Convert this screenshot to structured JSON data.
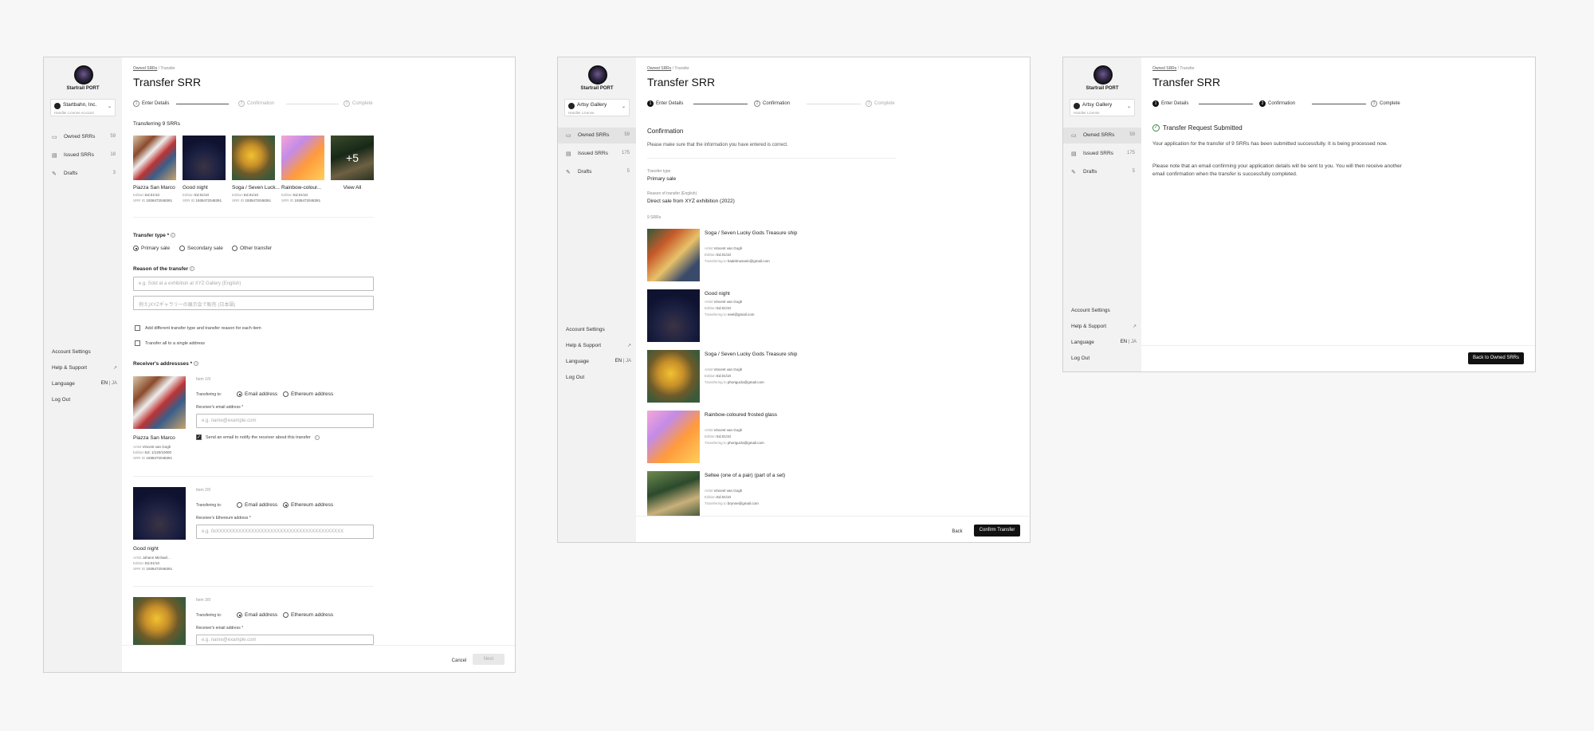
{
  "sidebar": {
    "brand": "Startrail PORT",
    "nav": [
      {
        "label": "Owned SRRs"
      },
      {
        "label": "Issued SRRs"
      },
      {
        "label": "Drafts"
      }
    ],
    "bottom": {
      "account_settings": "Account Settings",
      "help": "Help & Support",
      "language": "Language",
      "lang_en": "EN",
      "lang_ja": "JA",
      "logout": "Log Out"
    }
  },
  "screens": [
    {
      "account": {
        "name": "Startbahn, Inc.",
        "role": "Handler License Account"
      },
      "nav_counts": [
        "59",
        "18",
        "3"
      ],
      "breadcrumb": {
        "link": "Owned SRRs",
        "current": "Transfer"
      },
      "title": "Transfer SRR",
      "steps": [
        "Enter Details",
        "Confirmation",
        "Complete"
      ],
      "transferring_label": "Transferring 9 SRRs",
      "items": [
        {
          "name": "Piazza San Marco",
          "edition_label": "Edition",
          "edition": "Ed.01/10",
          "srr_label": "SRR ID",
          "srr": "1938472048391"
        },
        {
          "name": "Good night",
          "edition_label": "Edition",
          "edition": "Ed.01/10",
          "srr_label": "SRR ID",
          "srr": "1938472048391"
        },
        {
          "name": "Soga / Seven Luck...",
          "edition_label": "Edition",
          "edition": "Ed.01/10",
          "srr_label": "SRR ID",
          "srr": "1938472048391"
        },
        {
          "name": "Rainbow-colour...",
          "edition_label": "Edition",
          "edition": "Ed.01/10",
          "srr_label": "SRR ID",
          "srr": "1938472048391"
        }
      ],
      "more_count": "+5",
      "view_all": "View All",
      "transfer_type_label": "Transfer type *",
      "transfer_type_options": [
        "Primary sale",
        "Secondary sale",
        "Other transfer"
      ],
      "reason_label": "Reason of the transfer",
      "reason_placeholder_en": "e.g. Sold at a exhibition at XYZ Gallery (English)",
      "reason_placeholder_ja": "例え)XYZギャラリーの展示会で販売 (日本語)",
      "checkbox_different": "Add different transfer type and transfer reason for each item",
      "checkbox_single": "Transfer all to a single address",
      "receivers_label": "Receiver's addressses *",
      "receivers": [
        {
          "item": "Item 1/9",
          "name": "Piazza San Marco",
          "artist_label": "Artist",
          "artist": "Vincent van Gogh",
          "edition_label": "Edition",
          "edition": "Ed. 1/120/10000",
          "srr_label": "SRR ID",
          "srr": "1938472048391",
          "to_label": "Transfering to:",
          "opt_email": "Email address",
          "opt_eth": "Ethereum address",
          "field_label": "Receiver's email address *",
          "placeholder": "e.g. name@example.com",
          "notify": "Send an email to notify the receiver about this transfer"
        },
        {
          "item": "Item 2/9",
          "name": "Good night",
          "artist_label": "Artist",
          "artist": "Johann Michael...",
          "edition_label": "Edition",
          "edition": "Ed.01/10",
          "srr_label": "SRR ID",
          "srr": "1938472048391",
          "to_label": "Transfering to:",
          "opt_email": "Email address",
          "opt_eth": "Ethereum address",
          "field_label": "Receiver's Ethereum address *",
          "placeholder": "e.g. 0xXXXXXXXXXXXXXXXXXXXXXXXXXXXXXXXXXXXXXXXX"
        },
        {
          "item": "Item 3/9",
          "to_label": "Transfering to:",
          "opt_email": "Email address",
          "opt_eth": "Ethereum address",
          "field_label": "Receiver's email address *",
          "placeholder": "e.g. name@example.com"
        }
      ],
      "cancel": "Cancel",
      "next": "Next"
    },
    {
      "account": {
        "name": "Artsy Gallery",
        "role": "Handler License"
      },
      "nav_counts": [
        "59",
        "175",
        "5"
      ],
      "breadcrumb": {
        "link": "Owned SRRs",
        "current": "Transfer"
      },
      "title": "Transfer SRR",
      "steps": [
        "Enter Details",
        "Confirmation",
        "Complete"
      ],
      "heading": "Confirmation",
      "intro": "Please make sure that the information you have entered is correct.",
      "type_label": "Transfer type",
      "type_value": "Primary sale",
      "reason_label": "Reason of transfer (English)",
      "reason_value": "Direct sale from XYZ exhibition (2022)",
      "count_label": "9 SRRs",
      "entries": [
        {
          "title": "Soga / Seven Lucky Gods Treasure ship",
          "artist_label": "Artist",
          "artist": "Vincent van Gogh",
          "edition_label": "Edition",
          "edition": "Ed.01/10",
          "to_label": "Transfering to",
          "to": "hadelmussein@gmail.com"
        },
        {
          "title": "Good night",
          "artist_label": "Artist",
          "artist": "Vincent van Gogh",
          "edition_label": "Edition",
          "edition": "Ed.01/10",
          "to_label": "Transfering to",
          "to": "neel@gmail.com"
        },
        {
          "title": "Soga / Seven Lucky Gods Treasure ship",
          "artist_label": "Artist",
          "artist": "Vincent van Gogh",
          "edition_label": "Edition",
          "edition": "Ed.01/10",
          "to_label": "Transfering to",
          "to": "phorigucla@gmail.com"
        },
        {
          "title": "Rainbow-coloured frosted glass",
          "artist_label": "Artist",
          "artist": "Vincent van Gogh",
          "edition_label": "Edition",
          "edition": "Ed.01/10",
          "to_label": "Transfering to",
          "to": "phorigucla@gmail.com"
        },
        {
          "title": "Seltee (one of a pair) (part of a set)",
          "artist_label": "Artist",
          "artist": "Vincent van Gogh",
          "edition_label": "Edition",
          "edition": "Ed.01/10",
          "to_label": "Transfering to",
          "to": "brynne@gmail.com"
        }
      ],
      "back": "Back",
      "confirm": "Confirm Transfer"
    },
    {
      "account": {
        "name": "Artsy Gallery",
        "role": "Handler License"
      },
      "nav_counts": [
        "59",
        "175",
        "5"
      ],
      "breadcrumb": {
        "link": "Owned SRRs",
        "current": "Transfer"
      },
      "title": "Transfer SRR",
      "steps": [
        "Enter Details",
        "Confirmation",
        "Complete"
      ],
      "heading": "Transfer Request Submitted",
      "para1": "Your application for the transfer of 9 SRRs has been submitted successfully. It is being processed now.",
      "para2": "Please note that an email confirming your application details will be sent to you. You will then receive another email confirmation when the transfer is successfully completed.",
      "back_button": "Back to Owned SRRs"
    }
  ],
  "colors": {
    "accent": "#111111",
    "sidebar_bg": "#f2f2f2",
    "page_bg": "#f7f7f7"
  }
}
